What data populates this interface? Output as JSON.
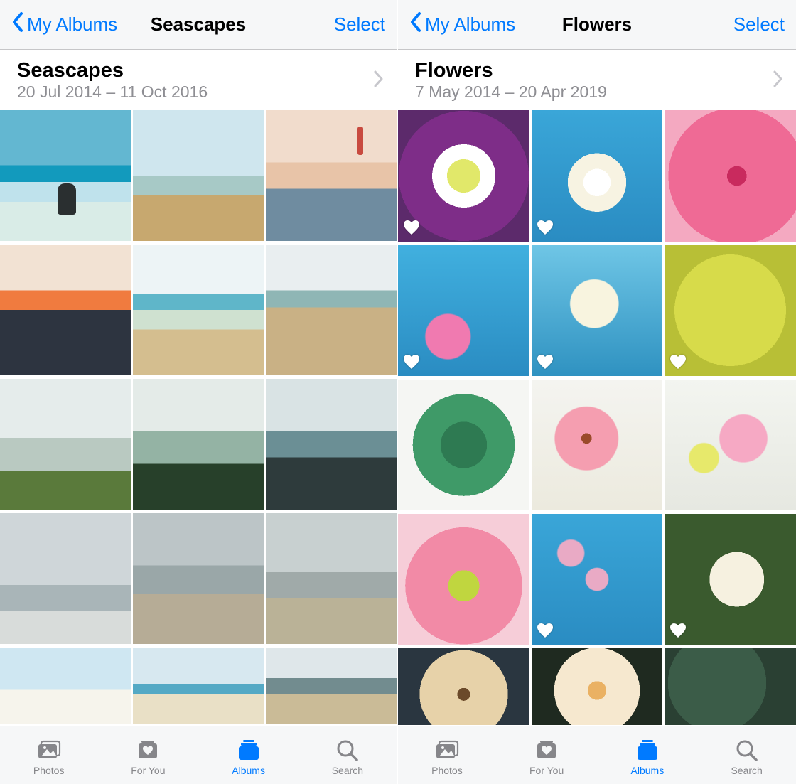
{
  "panes": [
    {
      "back_label": "My Albums",
      "title": "Seascapes",
      "select_label": "Select",
      "header": {
        "title": "Seascapes",
        "dates": "20 Jul 2014 – 11 Oct 2016"
      },
      "photos": [
        {
          "class": "sea-a1",
          "favorite": false
        },
        {
          "class": "sea-a2",
          "favorite": false
        },
        {
          "class": "sea-a3",
          "favorite": false
        },
        {
          "class": "sea-b1",
          "favorite": false
        },
        {
          "class": "sea-b2",
          "favorite": false
        },
        {
          "class": "sea-b3",
          "favorite": false
        },
        {
          "class": "sea-c1",
          "favorite": false
        },
        {
          "class": "sea-c2",
          "favorite": false
        },
        {
          "class": "sea-c3",
          "favorite": false
        },
        {
          "class": "sea-d1",
          "favorite": false
        },
        {
          "class": "sea-d2",
          "favorite": false
        },
        {
          "class": "sea-d3",
          "favorite": false
        },
        {
          "class": "sea-e1",
          "favorite": false,
          "partial": true
        },
        {
          "class": "sea-e2",
          "favorite": false,
          "partial": true
        },
        {
          "class": "sea-e3",
          "favorite": false,
          "partial": true
        }
      ]
    },
    {
      "back_label": "My Albums",
      "title": "Flowers",
      "select_label": "Select",
      "header": {
        "title": "Flowers",
        "dates": "7 May 2014 – 20 Apr 2019"
      },
      "photos": [
        {
          "class": "fl-a1",
          "favorite": true
        },
        {
          "class": "fl-a2",
          "favorite": true
        },
        {
          "class": "fl-a3",
          "favorite": false
        },
        {
          "class": "fl-b1",
          "favorite": true
        },
        {
          "class": "fl-b2",
          "favorite": true
        },
        {
          "class": "fl-b3",
          "favorite": true
        },
        {
          "class": "fl-c1",
          "favorite": false
        },
        {
          "class": "fl-c2",
          "favorite": false
        },
        {
          "class": "fl-c3",
          "favorite": false
        },
        {
          "class": "fl-d1",
          "favorite": false
        },
        {
          "class": "fl-d2",
          "favorite": true
        },
        {
          "class": "fl-d3",
          "favorite": true
        },
        {
          "class": "fl-e1",
          "favorite": false,
          "partial": true
        },
        {
          "class": "fl-e2",
          "favorite": false,
          "partial": true
        },
        {
          "class": "fl-e3",
          "favorite": false,
          "partial": true
        }
      ]
    }
  ],
  "tabs": [
    {
      "id": "photos",
      "label": "Photos",
      "active": false
    },
    {
      "id": "for-you",
      "label": "For You",
      "active": false
    },
    {
      "id": "albums",
      "label": "Albums",
      "active": true
    },
    {
      "id": "search",
      "label": "Search",
      "active": false
    }
  ]
}
